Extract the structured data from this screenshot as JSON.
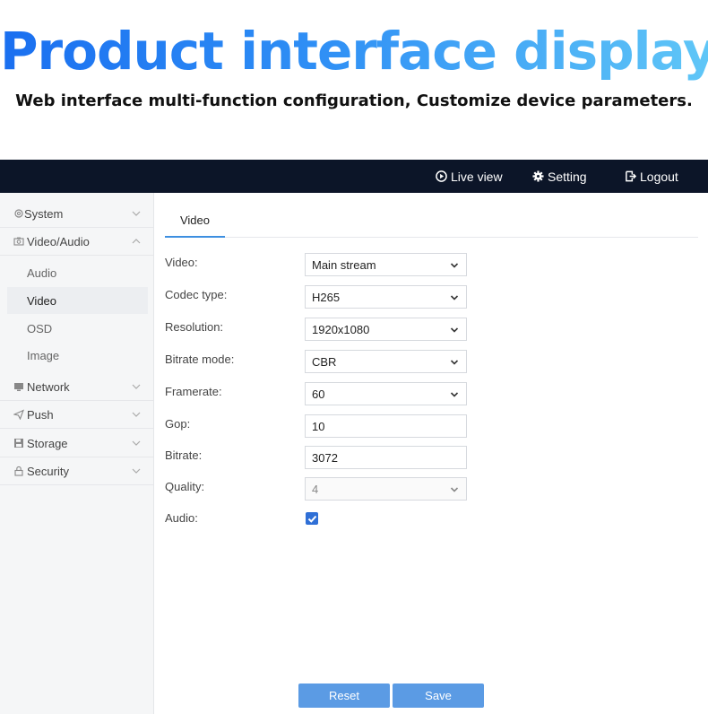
{
  "banner": {
    "title": "Product interface display",
    "subtitle": "Web interface multi-function configuration, Customize device parameters."
  },
  "topbar": {
    "live_view": "Live view",
    "setting": "Setting",
    "logout": "Logout"
  },
  "sidebar": {
    "system": "System",
    "video_audio": "Video/Audio",
    "sub_items": [
      "Audio",
      "Video",
      "OSD",
      "Image"
    ],
    "network": "Network",
    "push": "Push",
    "storage": "Storage",
    "security": "Security"
  },
  "main": {
    "tab": "Video",
    "fields": {
      "video": {
        "label": "Video:",
        "value": "Main stream"
      },
      "codec": {
        "label": "Codec type:",
        "value": "H265"
      },
      "resolution": {
        "label": "Resolution:",
        "value": "1920x1080"
      },
      "bitrate_mode": {
        "label": "Bitrate mode:",
        "value": "CBR"
      },
      "framerate": {
        "label": "Framerate:",
        "value": "60"
      },
      "gop": {
        "label": "Gop:",
        "value": "10"
      },
      "bitrate": {
        "label": "Bitrate:",
        "value": "3072"
      },
      "quality": {
        "label": "Quality:",
        "value": "4"
      },
      "audio": {
        "label": "Audio:",
        "checked": true
      }
    },
    "buttons": {
      "reset": "Reset",
      "save": "Save"
    }
  },
  "colors": {
    "topbar": "#0c1528",
    "accent": "#3d8fe0",
    "button": "#5b9be4",
    "checkbox": "#2f6fd6"
  }
}
